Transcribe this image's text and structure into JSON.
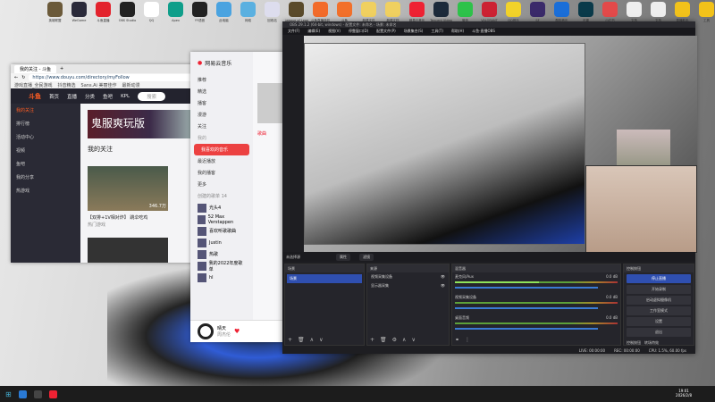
{
  "desktop": {
    "icons": [
      {
        "label": "英雄联盟",
        "color": "#6b5a3a"
      },
      {
        "label": "WeGame",
        "color": "#2a2a3a"
      },
      {
        "label": "斗鱼直播",
        "color": "#e3232d"
      },
      {
        "label": "OBS Studio",
        "color": "#222"
      },
      {
        "label": "QQ",
        "color": "#fff"
      },
      {
        "label": "Apex",
        "color": "#0f9e8a"
      },
      {
        "label": "YY语音",
        "color": "#222"
      },
      {
        "label": "此电脑",
        "color": "#4aa3e0"
      },
      {
        "label": "网络",
        "color": "#5ab0e0"
      },
      {
        "label": "回收站",
        "color": "#dde"
      },
      {
        "label": "League of Legends",
        "color": "#5a4a2a"
      },
      {
        "label": "斗鱼直播伴侣",
        "color": "#f26b2a"
      },
      {
        "label": "斗鱼",
        "color": "#f2702a"
      },
      {
        "label": "新建文件",
        "color": "#f0d060"
      },
      {
        "label": "新建文档",
        "color": "#f0d060"
      },
      {
        "label": "网易云音乐",
        "color": "#e23"
      },
      {
        "label": "Tencent Video",
        "color": "#1c2a3a"
      },
      {
        "label": "微信",
        "color": "#2ec24a"
      },
      {
        "label": "VALORANT",
        "color": "#c23"
      },
      {
        "label": "QQ音乐",
        "color": "#f2d22a"
      },
      {
        "label": "SF",
        "color": "#3a2a6a"
      },
      {
        "label": "酷狗音乐",
        "color": "#1a6ed8"
      },
      {
        "label": "迅雷",
        "color": "#0a3a4a"
      },
      {
        "label": "小红书",
        "color": "#e24a4a"
      },
      {
        "label": "文档",
        "color": "#eee"
      },
      {
        "label": "文档",
        "color": "#eee"
      },
      {
        "label": "直播助手",
        "color": "#f2c21a"
      },
      {
        "label": "工具",
        "color": "#f2c21a"
      }
    ]
  },
  "browser": {
    "tab": "我的关注 - 斗鱼",
    "url": "https://www.douyu.com/directory/myFollow",
    "bookmarks": [
      "游戏直播_全民游戏",
      "抖音精选",
      "Sans.Ai 美丽佳作",
      "最新动漫"
    ],
    "logo": "斗鱼",
    "nav": [
      "首页",
      "直播",
      "分类",
      "鱼吧",
      "KPL"
    ],
    "search_placeholder": "搜索",
    "side": [
      "我的关注",
      "排行榜",
      "活动中心",
      "视频",
      "鱼吧",
      "我的分享",
      "热游戏"
    ],
    "banner": "鬼服爽玩版",
    "section": "我的关注",
    "card_title": "【双排+1V相对炸】 跳伞吃鸡",
    "card_sub": "热门游戏",
    "card_count": "346.7万"
  },
  "music": {
    "app": "网易云音乐",
    "nav": [
      "推荐",
      "精选",
      "播客",
      "漫游",
      "关注"
    ],
    "my_label": "我的",
    "active": "我喜欢的音乐",
    "items": [
      "最近播放",
      "我的播客",
      "更多"
    ],
    "playlist_header": "创建的歌单 14",
    "playlists": [
      "光头4",
      "52 Max Verstappen",
      "喜欢听歌歌曲",
      "Justin",
      "热歌",
      "我的2022年度歌单",
      "hl"
    ],
    "tab": "歌曲",
    "now_playing": "晴天",
    "artist": "周杰伦"
  },
  "obs": {
    "title": "OBS 29.1.2 (64-bit, windows) - 配置文件: 未命名 - 场景: 未命名",
    "menu": [
      "文件(F)",
      "编辑(E)",
      "视图(V)",
      "停靠窗口(D)",
      "配置文件(P)",
      "场景集合(S)",
      "工具(T)",
      "帮助(H)",
      "斗鱼-直播OBS"
    ],
    "toolbar": {
      "selected": "未选择源",
      "props": "属性",
      "filters": "滤镜"
    },
    "scenes": {
      "title": "场景",
      "items": [
        "场景"
      ]
    },
    "sources": {
      "title": "来源",
      "items": [
        "视频采集设备",
        "显示器采集"
      ]
    },
    "mixer": {
      "title": "混音器",
      "channels": [
        {
          "name": "麦克风/Aux",
          "db": "0.0 dB",
          "level": 0.55
        },
        {
          "name": "视频采集设备",
          "db": "0.0 dB",
          "level": 0.0
        },
        {
          "name": "桌面音频",
          "db": "0.0 dB",
          "level": 0.0
        }
      ]
    },
    "controls": {
      "title": "控制按钮",
      "buttons": [
        "停止直播",
        "开始录制",
        "启动虚拟摄像机",
        "工作室模式",
        "设置",
        "退出"
      ],
      "tabs": [
        "控制按钮",
        "转场特效"
      ]
    },
    "status": {
      "live": "LIVE: 00:00:00",
      "rec": "REC: 00:00:00",
      "cpu": "CPU: 1.5%, 60.00 fps"
    }
  },
  "taskbar": {
    "time": "19:01",
    "date": "2026/2/8"
  }
}
